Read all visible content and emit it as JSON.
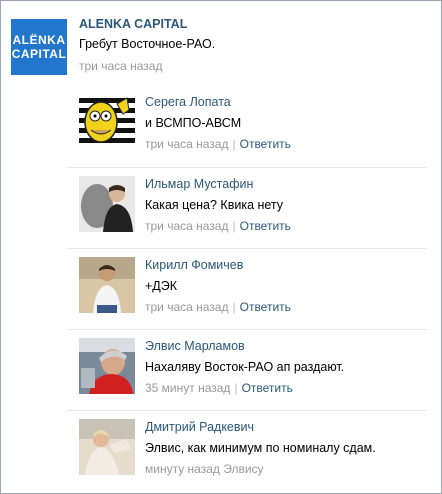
{
  "post": {
    "logo_line1": "ALЁNKA",
    "logo_line2": "CAPITAL",
    "author": "ALENKA CAPITAL",
    "text": "Гребут Восточное-РАО.",
    "time": "три часа назад"
  },
  "comments": [
    {
      "name": "Серега Лопата",
      "text": "и ВСМПО-АВСМ",
      "time": "три часа назад",
      "sep": "|",
      "action": "Ответить"
    },
    {
      "name": "Ильмар Мустафин",
      "text": "Какая цена? Квика нету",
      "time": "три часа назад",
      "sep": "|",
      "action": "Ответить"
    },
    {
      "name": "Кирилл Фомичев",
      "text": "+ДЭК",
      "time": "три часа назад",
      "sep": "|",
      "action": "Ответить"
    },
    {
      "name": "Элвис Марламов",
      "text": "Нахаляву Восток-РАО ап раздают.",
      "time": "35 минут назад",
      "sep": "|",
      "action": "Ответить"
    },
    {
      "name": "Дмитрий Радкевич",
      "text": "Элвис, как минимум по номиналу сдам.",
      "time": "минуту назад Элвису"
    }
  ]
}
